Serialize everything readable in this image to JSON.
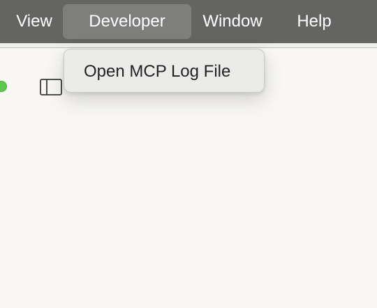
{
  "menubar": {
    "items": [
      {
        "label": "View"
      },
      {
        "label": "Developer",
        "active": true
      },
      {
        "label": "Window"
      },
      {
        "label": "Help"
      }
    ]
  },
  "dropdown": {
    "items": [
      {
        "label": "Open MCP Log File"
      }
    ]
  },
  "window": {
    "toolbar_icons": [
      "traffic-light-green-icon",
      "sidebar-toggle-icon"
    ]
  },
  "colors": {
    "menubar_bg": "#646462",
    "menu_highlight": "#7e7e7c",
    "content_bg": "#f8f7f3",
    "dropdown_bg": "#ebebea",
    "traffic_green": "#5ac94d"
  }
}
